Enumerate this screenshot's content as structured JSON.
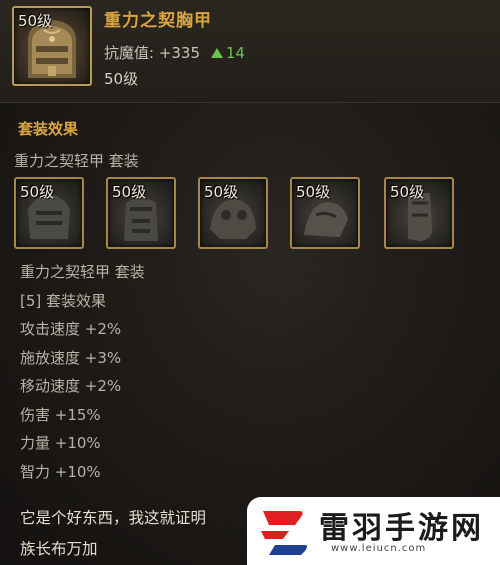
{
  "item": {
    "name": "重力之契胸甲",
    "icon": "chest-armor-icon",
    "icon_level": "50级",
    "stat_label": "抗魔值: +335",
    "stat_delta": "14",
    "level": "50级"
  },
  "set": {
    "section_title": "套装效果",
    "set_name": "重力之契轻甲 套装",
    "pieces": [
      {
        "level": "50级",
        "icon": "armor-piece-icon"
      },
      {
        "level": "50级",
        "icon": "armor-piece-icon"
      },
      {
        "level": "50级",
        "icon": "armor-piece-icon"
      },
      {
        "level": "50级",
        "icon": "armor-piece-icon"
      },
      {
        "level": "50级",
        "icon": "armor-piece-icon"
      }
    ],
    "effects_header": "重力之契轻甲 套装",
    "effect_count": "[5] 套装效果",
    "effects": [
      "攻击速度 +2%",
      "施放速度 +3%",
      "移动速度 +2%",
      "伤害 +15%",
      "力量 +10%",
      "智力 +10%"
    ]
  },
  "description": {
    "line1": "它是个好东西，我这就证明",
    "line2": "族长布万加"
  },
  "watermark": {
    "text": "雷羽手游网",
    "url": "www.leiucn.com"
  },
  "colors": {
    "title_gold": "#d9a441",
    "stat_green": "#6cc24a",
    "frame_gold": "#b99b58"
  }
}
